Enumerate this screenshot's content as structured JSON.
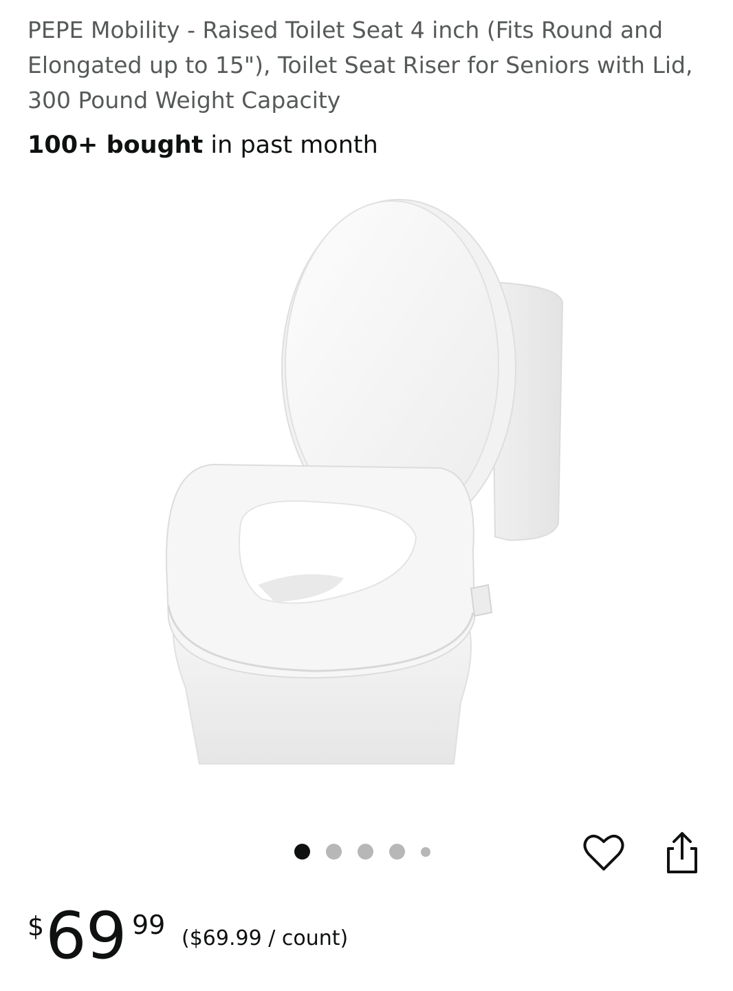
{
  "product": {
    "title": "PEPE Mobility - Raised Toilet Seat 4 inch (Fits Round and Elongated up to 15\"), Toilet Seat Riser for Seniors with Lid, 300 Pound Weight Capacity",
    "bought_count": "100+ bought",
    "bought_suffix": " in past month"
  },
  "gallery": {
    "image_alt": "Raised toilet seat with lid installed on a white toilet",
    "total_images": 5,
    "active_index": 0
  },
  "actions": {
    "favorite_icon": "heart-icon",
    "share_icon": "share-icon"
  },
  "price": {
    "symbol": "$",
    "whole": "69",
    "fraction": "99",
    "unit_price": "($69.99 / count)"
  },
  "colors": {
    "text_primary": "#0f1111",
    "text_secondary": "#565959",
    "dot_inactive": "#b7b7b7"
  }
}
